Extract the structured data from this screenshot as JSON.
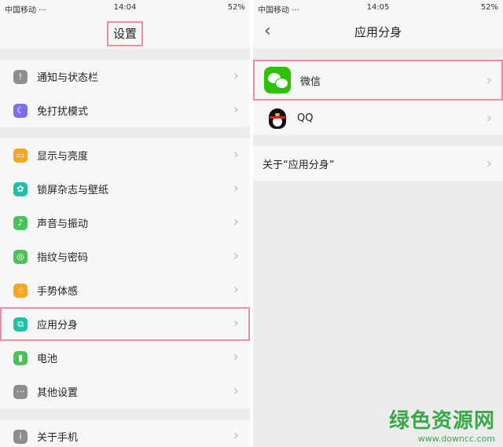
{
  "left": {
    "status": {
      "carrier": "中国移动 ···",
      "time": "14:04",
      "battery": "52%"
    },
    "title": "设置",
    "groups": [
      {
        "items": [
          {
            "label": "通知与状态栏",
            "icon": "notification-icon",
            "color": "#8e8e8e",
            "glyph": "!"
          },
          {
            "label": "免打扰模式",
            "icon": "moon-icon",
            "color": "#7a6ff0",
            "glyph": "☾"
          }
        ]
      },
      {
        "items": [
          {
            "label": "显示与亮度",
            "icon": "display-icon",
            "color": "#f5a623",
            "glyph": "▭"
          },
          {
            "label": "锁屏杂志与壁纸",
            "icon": "wallpaper-icon",
            "color": "#1fbfa8",
            "glyph": "✿"
          },
          {
            "label": "声音与振动",
            "icon": "sound-icon",
            "color": "#4cc15a",
            "glyph": "♪"
          },
          {
            "label": "指纹与密码",
            "icon": "fingerprint-icon",
            "color": "#4cc15a",
            "glyph": "◎"
          },
          {
            "label": "手势体感",
            "icon": "gesture-icon",
            "color": "#f5a623",
            "glyph": "☝"
          },
          {
            "label": "应用分身",
            "icon": "app-clone-icon",
            "color": "#1fbfa8",
            "glyph": "⧉",
            "highlight": true
          },
          {
            "label": "电池",
            "icon": "battery-icon",
            "color": "#4cc15a",
            "glyph": "▮"
          },
          {
            "label": "其他设置",
            "icon": "more-icon",
            "color": "#8e8e8e",
            "glyph": "···"
          }
        ]
      },
      {
        "items": [
          {
            "label": "关于手机",
            "icon": "info-icon",
            "color": "#8e8e8e",
            "glyph": "i"
          }
        ]
      }
    ]
  },
  "right": {
    "status": {
      "carrier": "中国移动 ···",
      "time": "14:05",
      "battery": "52%"
    },
    "title": "应用分身",
    "apps": [
      {
        "label": "微信",
        "icon": "wechat-icon",
        "highlight": true
      },
      {
        "label": "QQ",
        "icon": "qq-icon"
      }
    ],
    "about_label": "关于“应用分身”"
  },
  "watermark": {
    "cn": "绿色资源网",
    "url": "www.downcc.com"
  }
}
